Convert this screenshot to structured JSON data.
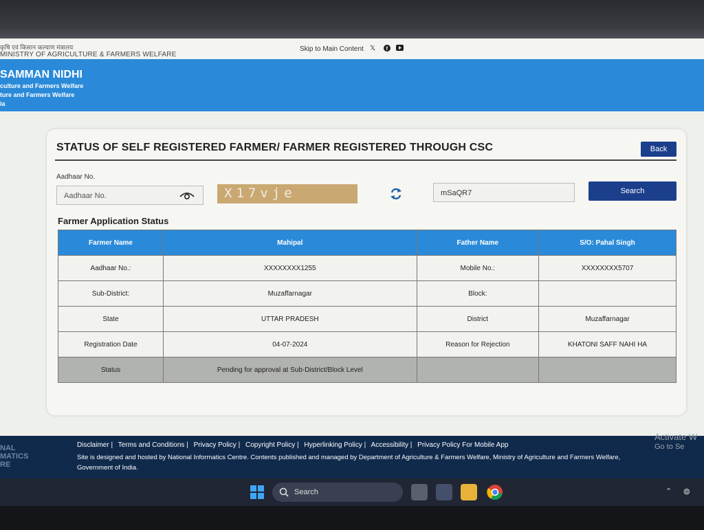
{
  "header": {
    "ministry_hindi": "कृषि एवं किसान कल्याण मंत्रालय",
    "ministry_english": "MINISTRY OF AGRICULTURE & FARMERS WELFARE",
    "skip_link": "Skip to Main Content",
    "social_icons": [
      "x-icon",
      "facebook-icon",
      "youtube-icon"
    ]
  },
  "banner": {
    "brand": "SAMMAN NIDHI",
    "sub1": "culture and Farmers Welfare",
    "sub2": "ture and Farmers Welfare",
    "sub3": "ia"
  },
  "page": {
    "title": "STATUS OF SELF REGISTERED FARMER/ FARMER REGISTERED THROUGH CSC",
    "back_label": "Back",
    "aadhaar_label": "Aadhaar No.",
    "aadhaar_placeholder": "Aadhaar No.",
    "captcha_text": "X17vje",
    "captcha_input_value": "mSaQR7",
    "search_label": "Search",
    "section_title": "Farmer Application Status"
  },
  "status_table": {
    "row1": [
      "Farmer Name",
      "Mahipal",
      "Father Name",
      "S/O: Pahal Singh"
    ],
    "row2": [
      "Aadhaar No.:",
      "XXXXXXXX1255",
      "Mobile No.:",
      "XXXXXXXX5707"
    ],
    "row3": [
      "Sub-District:",
      "Muzaffarnagar",
      "Block:",
      ""
    ],
    "row4": [
      "State",
      "UTTAR PRADESH",
      "District",
      "Muzaffarnagar"
    ],
    "row5": [
      "Registration Date",
      "04-07-2024",
      "Reason for Rejection",
      "KHATONI SAFF NAHI HA"
    ],
    "row6": [
      "Status",
      "Pending for approval at Sub-District/Block Level",
      "",
      ""
    ]
  },
  "footer": {
    "nic_text": "NAL\nMATICS\nRE",
    "links": [
      "Disclaimer",
      "Terms and Conditions",
      "Privacy Policy",
      "Copyright Policy",
      "Hyperlinking Policy",
      "Accessibility",
      "Privacy Policy For Mobile App"
    ],
    "disclaimer": "Site is designed and hosted by National Informatics Centre. Contents published and managed by Department of Agriculture & Farmers Welfare, Ministry of Agriculture and Farmers Welfare, Government of India.",
    "activate_line1": "Activate W",
    "activate_line2": "Go to Se"
  },
  "taskbar": {
    "search_label": "Search"
  },
  "colors": {
    "banner_blue": "#2a8ad9",
    "button_navy": "#1c3f8c",
    "footer_navy": "#102a4c"
  }
}
